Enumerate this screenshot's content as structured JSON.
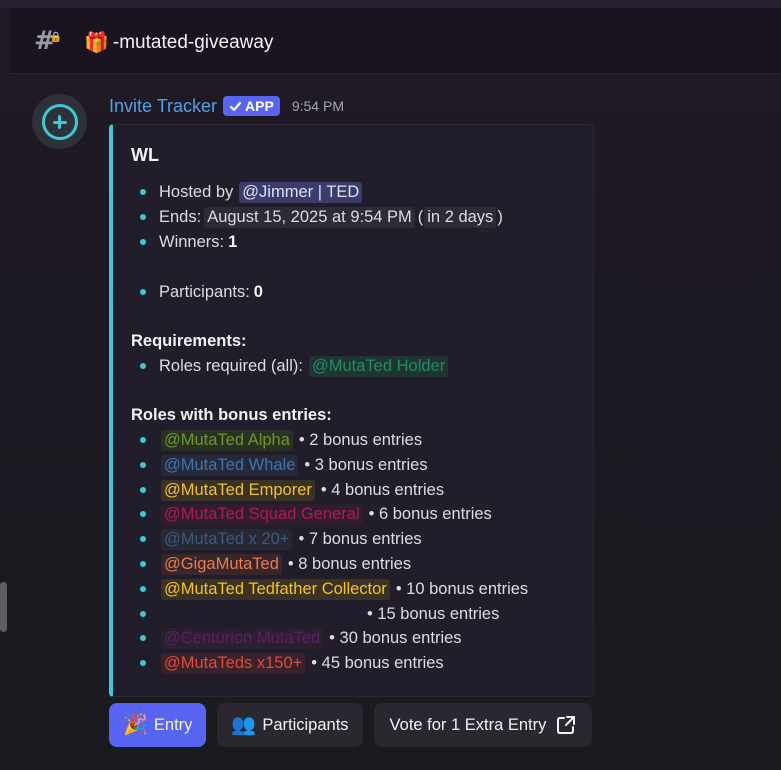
{
  "channel": {
    "name": "-mutated-giveaway",
    "icon": "locked-hash-icon",
    "emoji": "🎁"
  },
  "message": {
    "author": "Invite Tracker",
    "badge": "APP",
    "timestamp": "9:54 PM",
    "avatar_icon": "plus-circle-icon",
    "accent_color": "#3ec7d4"
  },
  "embed": {
    "title": "WL",
    "hosted_label": "Hosted by",
    "host": "@Jimmer | TED",
    "ends_label": "Ends:",
    "ends_date": "August 15, 2025 at 9:54 PM",
    "ends_paren_open": "(",
    "ends_relative": "in 2 days",
    "ends_paren_close": ")",
    "winners_label": "Winners:",
    "winners": "1",
    "participants_label": "Participants:",
    "participants": "0",
    "requirements_heading": "Requirements:",
    "roles_required_label": "Roles required (all):",
    "roles_required_role": {
      "name": "@MutaTed Holder",
      "color": "#1f8b6d",
      "bg": "#203530"
    },
    "bonus_heading": "Roles with bonus entries:",
    "bonus_roles": [
      {
        "role": "@MutaTed Alpha",
        "entries": "• 2 bonus entries",
        "color": "#6a9a1f",
        "bg": "#2a3026"
      },
      {
        "role": "@MutaTed Whale",
        "entries": "• 3 bonus entries",
        "color": "#3f74b0",
        "bg": "#26293a"
      },
      {
        "role": "@MutaTed Emporer",
        "entries": "• 4 bonus entries",
        "color": "#f0c428",
        "bg": "#3b3226"
      },
      {
        "role": "@MutaTed Squad General",
        "entries": "• 6 bonus entries",
        "color": "#b3175e",
        "bg": "#2f1f2d"
      },
      {
        "role": "@MutaTed x 20+",
        "entries": "• 7 bonus entries",
        "color": "#3d5a78",
        "bg": "#262834"
      },
      {
        "role": "@GigaMutaTed",
        "entries": "• 8 bonus entries",
        "color": "#e87c52",
        "bg": "#37272b"
      },
      {
        "role": "@MutaTed Tedfather Collector",
        "entries": "• 10 bonus entries",
        "color": "#f5c518",
        "bg": "#3b3224"
      },
      {
        "role": "",
        "entries": "• 15 bonus entries",
        "color": "#221d2a",
        "bg": "transparent"
      },
      {
        "role": "@Centurion MutaTed",
        "entries": "• 30 bonus entries",
        "color": "#5c1f66",
        "bg": "#2a2030"
      },
      {
        "role": "@MutaTeds x150+",
        "entries": "• 45 bonus entries",
        "color": "#e8463e",
        "bg": "#38232a"
      }
    ]
  },
  "buttons": {
    "entry": {
      "label": "Entry",
      "emoji": "🎉"
    },
    "participants": {
      "label": "Participants",
      "emoji": "👥"
    },
    "vote": {
      "label": "Vote for 1 Extra Entry",
      "icon": "external-link-icon"
    }
  }
}
